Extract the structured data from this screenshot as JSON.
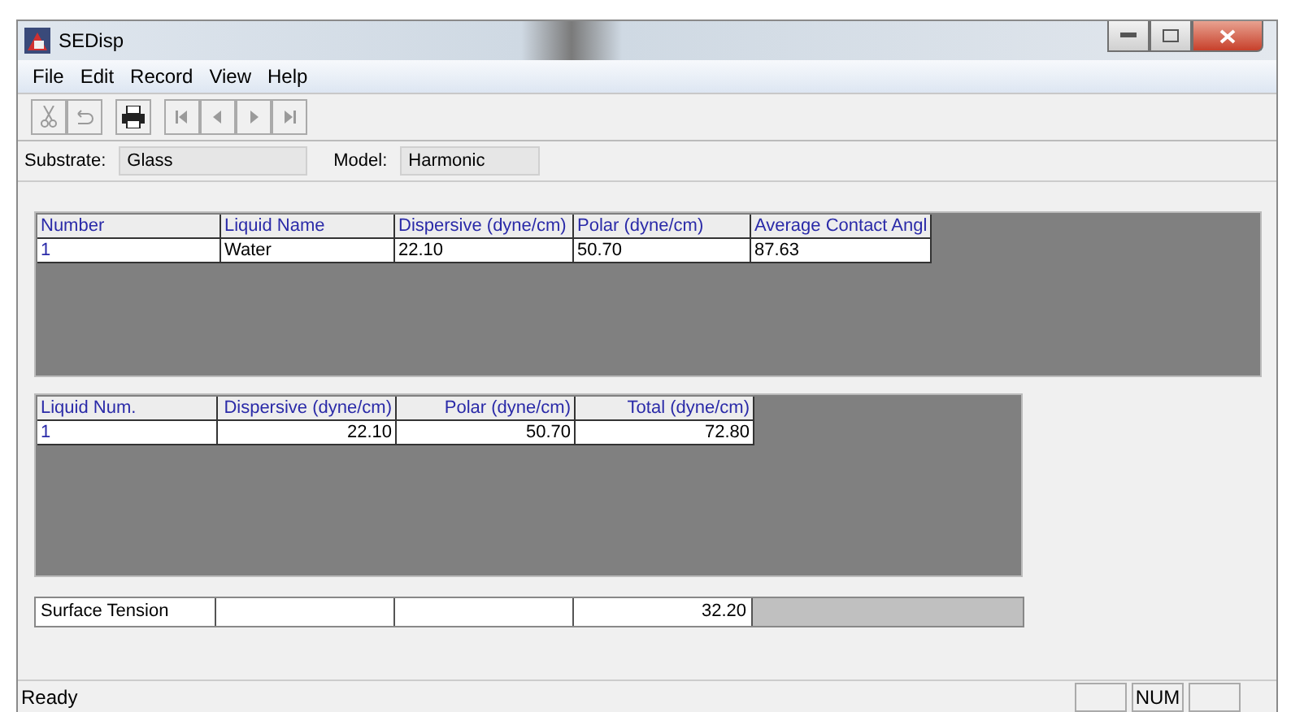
{
  "window": {
    "title": "SEDisp"
  },
  "menu": [
    "File",
    "Edit",
    "Record",
    "View",
    "Help"
  ],
  "toolbar": [
    {
      "kind": "cut",
      "disabled": true
    },
    {
      "kind": "undo",
      "disabled": true
    },
    {
      "kind": "print",
      "disabled": false
    },
    {
      "kind": "first",
      "disabled": true
    },
    {
      "kind": "prev",
      "disabled": true
    },
    {
      "kind": "next",
      "disabled": true
    },
    {
      "kind": "last",
      "disabled": true
    }
  ],
  "fields": [
    {
      "label": "Substrate:",
      "value": "Glass"
    },
    {
      "label": "Model:",
      "value": "Harmonic"
    }
  ],
  "liquids_table": {
    "columns": [
      "Number",
      "Liquid Name",
      "Dispersive (dyne/cm)",
      "Polar (dyne/cm)",
      "Average Contact Angl"
    ],
    "rows": [
      [
        "1",
        "Water",
        "22.10",
        "50.70",
        "87.63"
      ]
    ]
  },
  "results_table": {
    "columns": [
      "Liquid Num.",
      "Dispersive (dyne/cm)",
      "Polar (dyne/cm)",
      "Total (dyne/cm)"
    ],
    "rows": [
      [
        "1",
        "22.10",
        "50.70",
        "72.80"
      ]
    ]
  },
  "surface_tension": {
    "label": "Surface Tension",
    "total": "32.20"
  },
  "status_bar": {
    "text": "Ready",
    "indicator": "NUM"
  }
}
